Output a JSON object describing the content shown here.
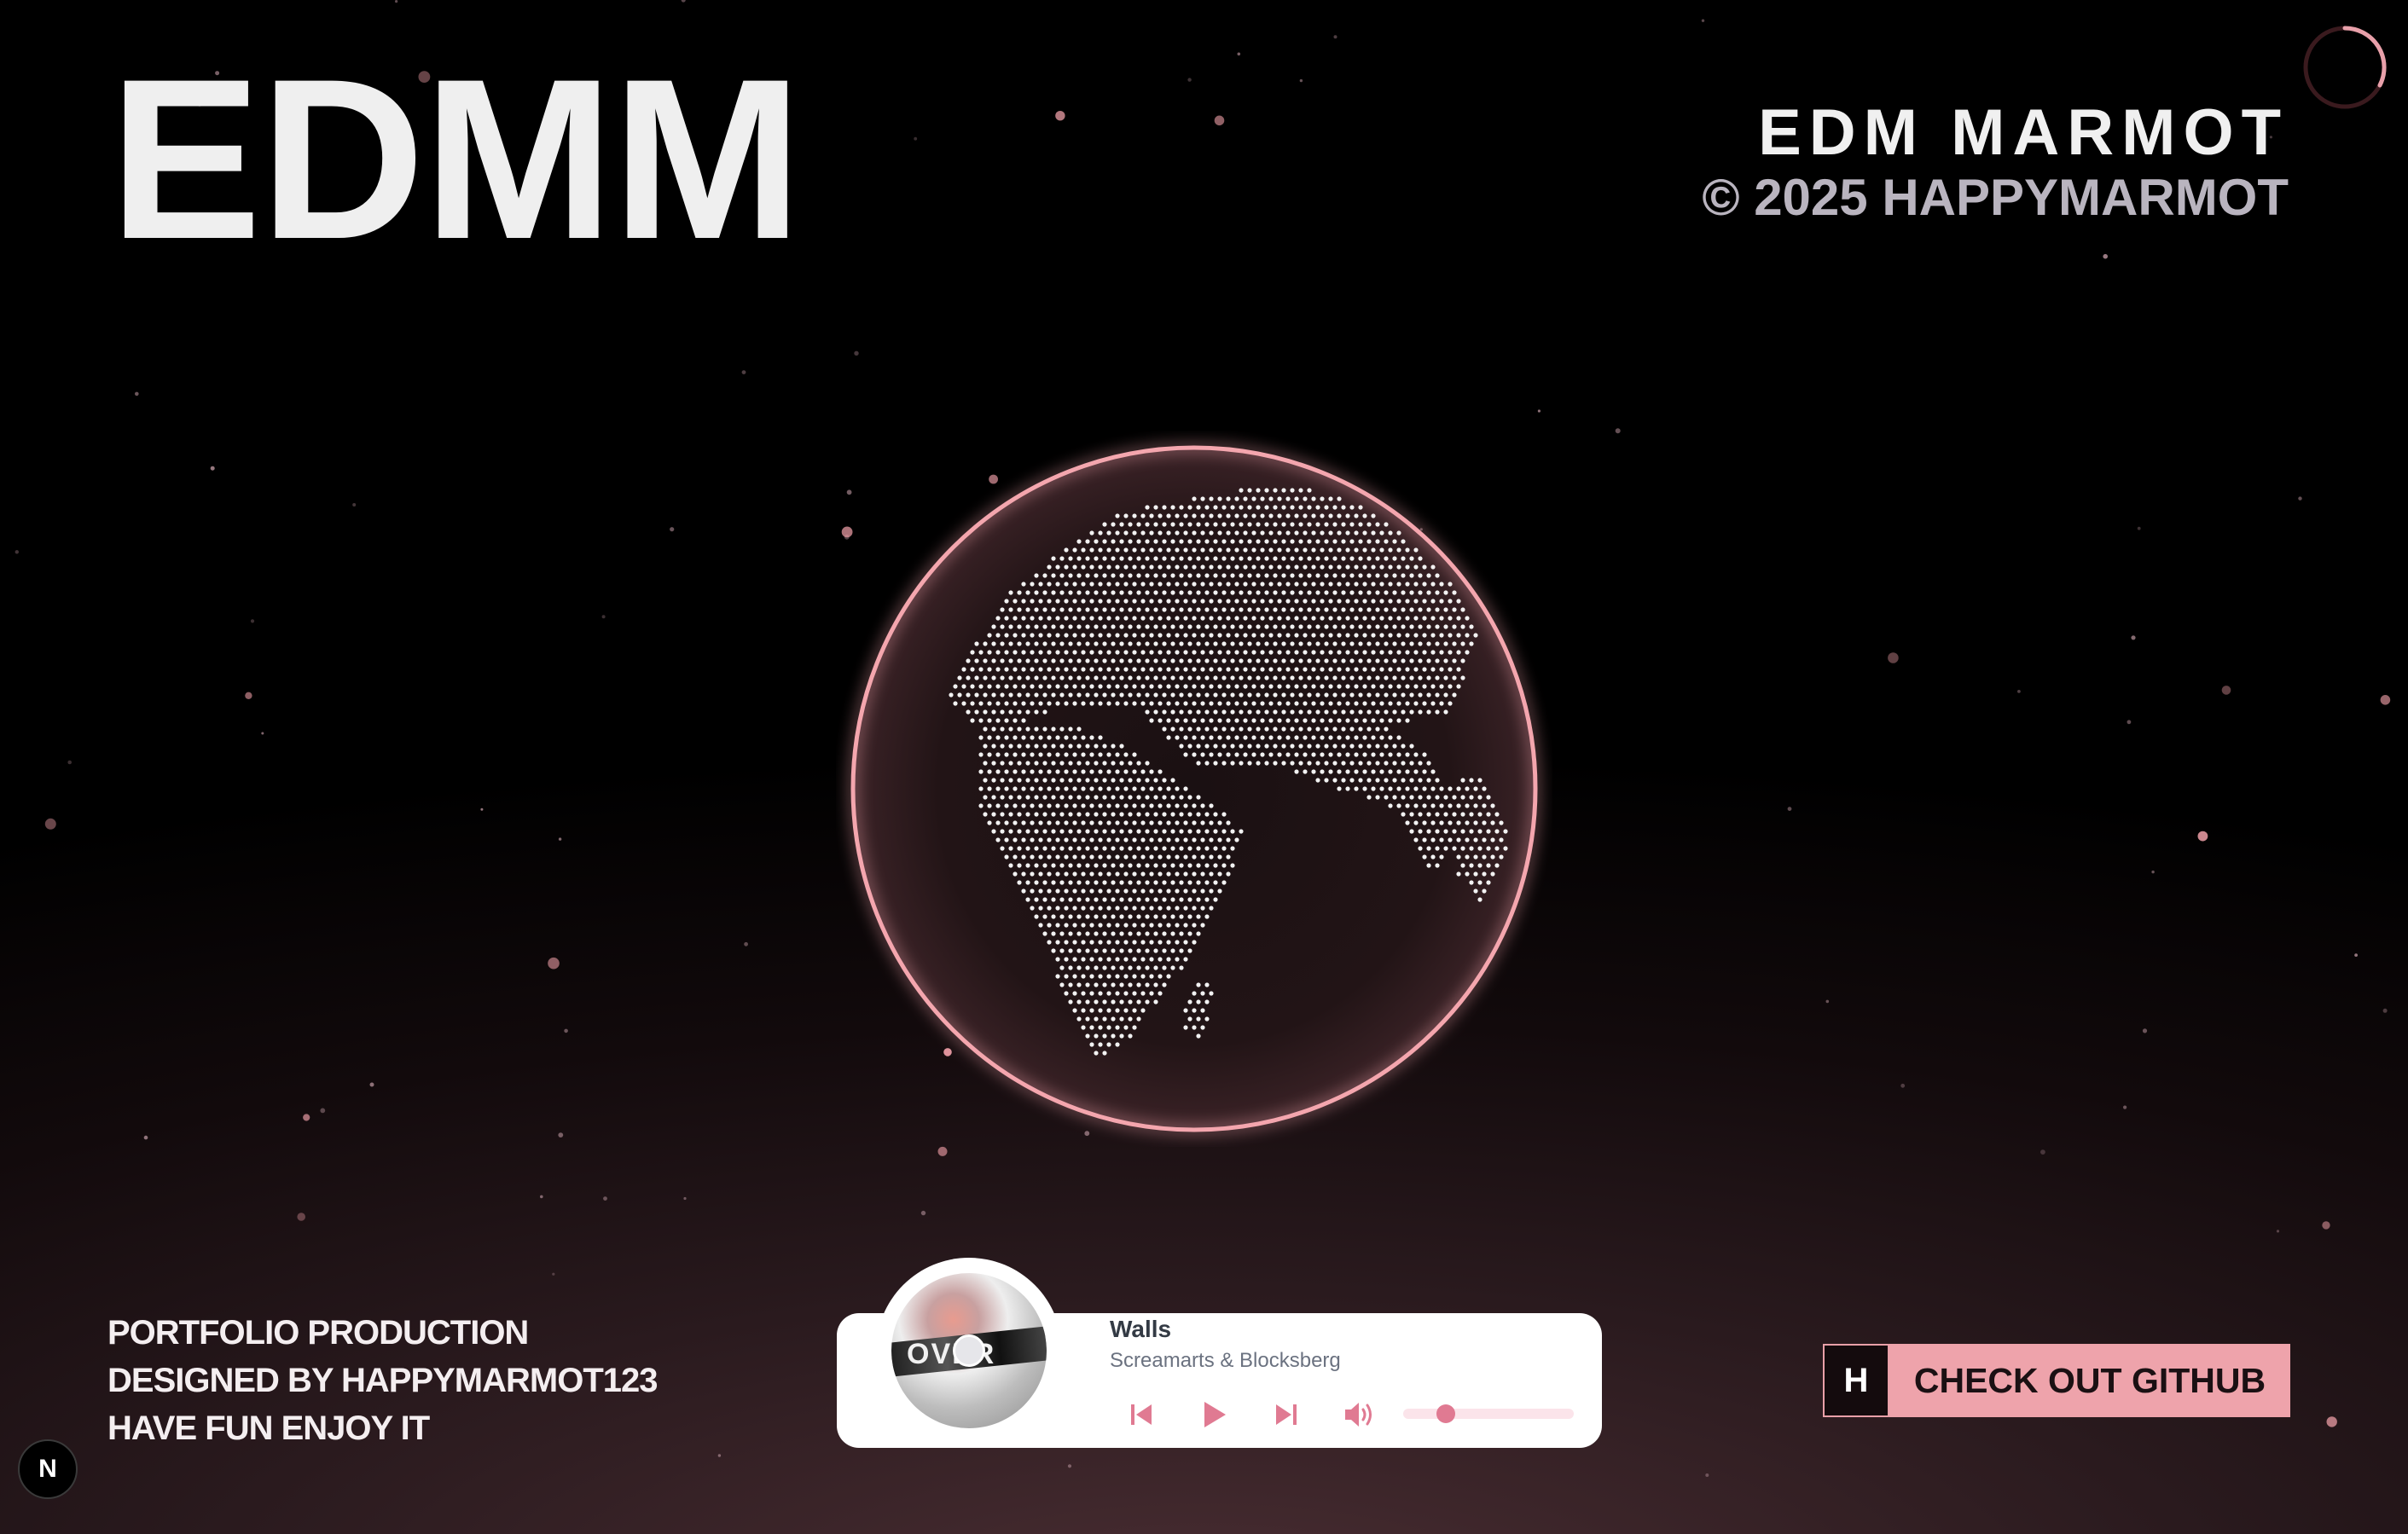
{
  "header": {
    "logo": "EDMM",
    "brand_name": "EDM MARMOT",
    "copyright": "© 2025 HAPPYMARMOT"
  },
  "footer": {
    "lines": [
      "PORTFOLIO PRODUCTION",
      "DESIGNED BY HAPPYMARMOT123",
      "HAVE FUN ENJOY IT"
    ]
  },
  "player": {
    "title": "Walls",
    "artist": "Screamarts & Blocksberg",
    "cover_text": "OVER",
    "volume": 0.25,
    "controls": [
      "skip-back-icon",
      "play-icon",
      "skip-forward-icon",
      "volume-icon"
    ]
  },
  "github_button": {
    "badge": "H",
    "label": "CHECK OUT GITHUB"
  },
  "next_badge": "N",
  "colors": {
    "accent": "#eea3ab",
    "accent_dark": "#e07a92",
    "globe_ring": "#f4a6ae",
    "text_light": "#efefef",
    "copyright": "#b9b4bf"
  }
}
